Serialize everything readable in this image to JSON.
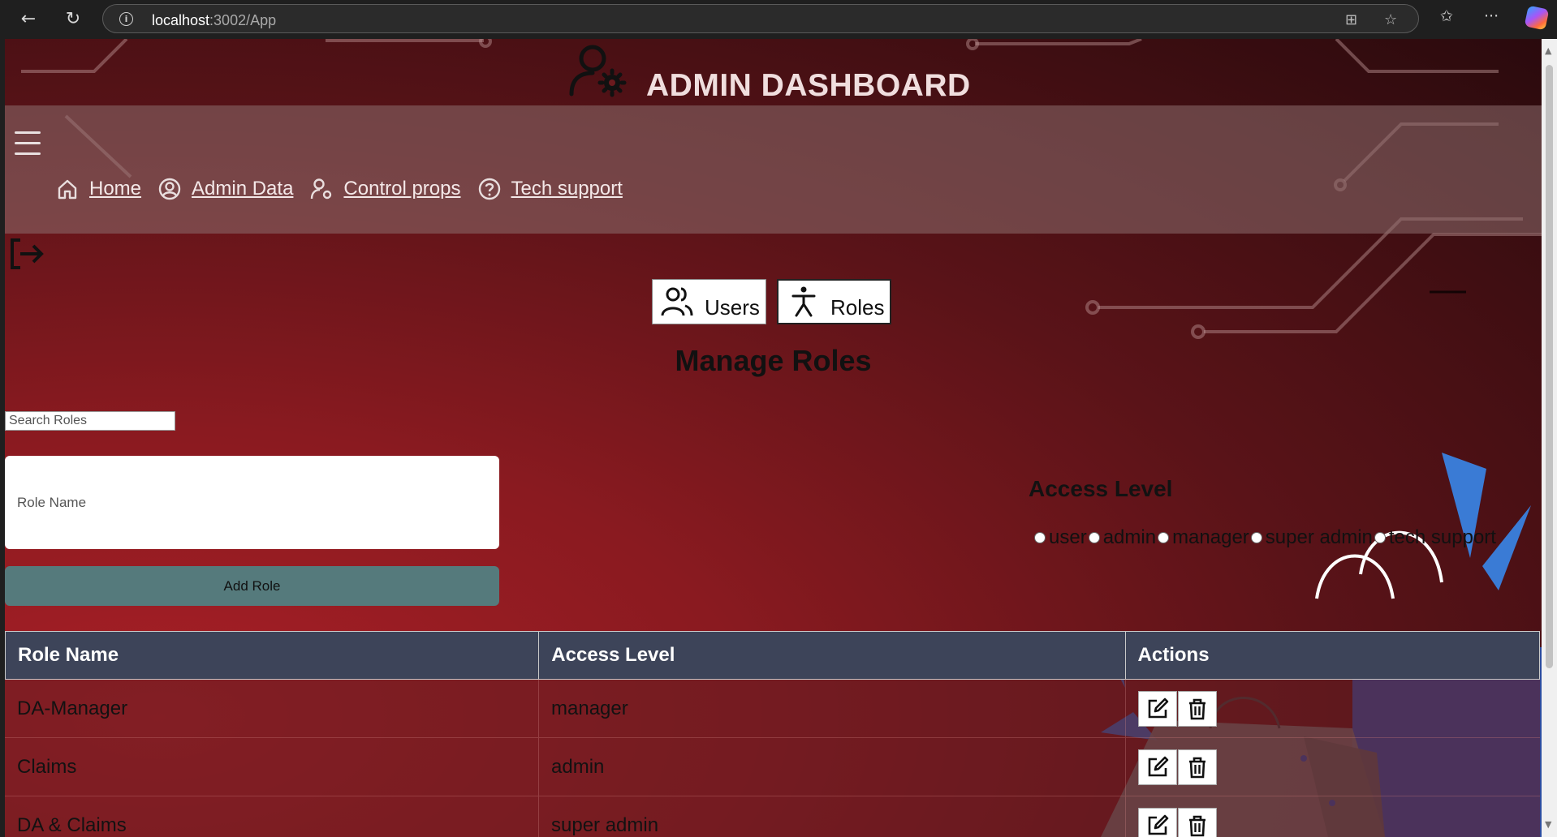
{
  "browser": {
    "url_host": "localhost",
    "url_path": ":3002/App"
  },
  "header": {
    "title": "ADMIN DASHBOARD",
    "icon": "user-gear-icon"
  },
  "nav": {
    "items": [
      {
        "label": "Home",
        "icon": "home-icon"
      },
      {
        "label": "Admin Data",
        "icon": "user-circle-icon"
      },
      {
        "label": "Control props",
        "icon": "user-gear-icon"
      },
      {
        "label": "Tech support",
        "icon": "help-circle-icon"
      }
    ]
  },
  "tabs": [
    {
      "label": "Users",
      "icon": "users-icon",
      "active": false
    },
    {
      "label": "Roles",
      "icon": "person-icon",
      "active": true
    }
  ],
  "page_title": "Manage Roles",
  "search": {
    "placeholder": "Search Roles"
  },
  "form": {
    "role_name_placeholder": "Role Name",
    "add_button": "Add Role"
  },
  "access_level": {
    "title": "Access Level",
    "options": [
      "user",
      "admin",
      "manager",
      "super admin",
      "tech support"
    ]
  },
  "table": {
    "headers": [
      "Role Name",
      "Access Level",
      "Actions"
    ],
    "rows": [
      {
        "role": "DA-Manager",
        "access": "manager"
      },
      {
        "role": "Claims",
        "access": "admin"
      },
      {
        "role": "DA & Claims",
        "access": "super admin"
      }
    ]
  },
  "colors": {
    "header_bg": "#3d4459",
    "add_button": "#557a7c",
    "page_bg": "#8a1a20"
  }
}
